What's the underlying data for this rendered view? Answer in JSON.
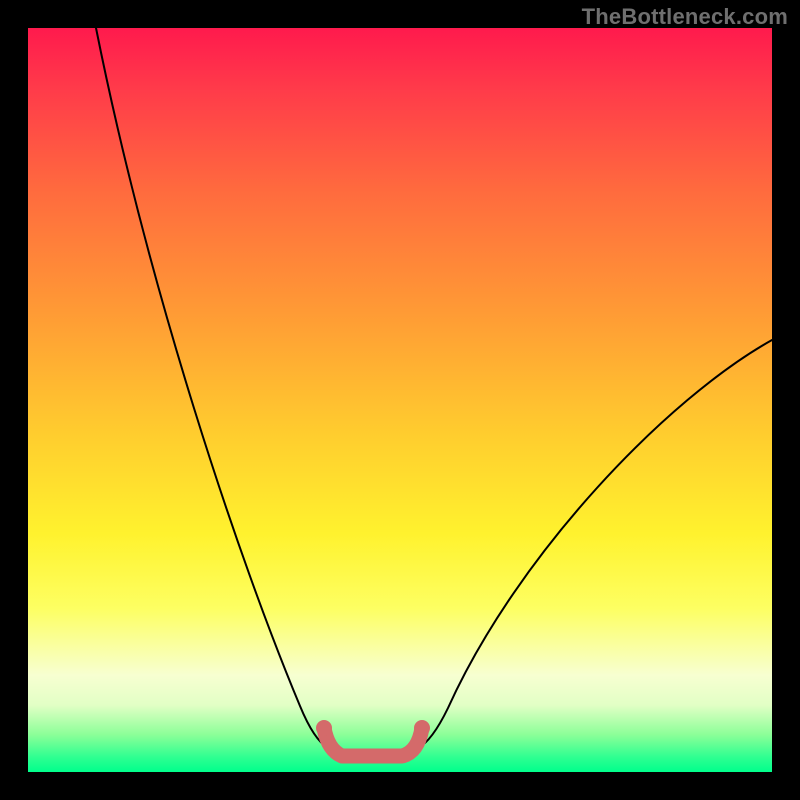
{
  "watermark": "TheBottleneck.com",
  "chart_data": {
    "type": "line",
    "title": "",
    "xlabel": "",
    "ylabel": "",
    "description": "Bottleneck V-curve: vertical axis is bottleneck percentage (high at top, 0 at bottom). Background gradient red→orange→yellow→green encodes severity. Two black curves descend to a minimum near x≈0.43 where a salmon U-shaped mark highlights the optimal zone.",
    "x_range_normalized": [
      0,
      1
    ],
    "y_range_percent": [
      0,
      100
    ],
    "gradient_stops": [
      {
        "pct": 0,
        "color": "#ff1a4d"
      },
      {
        "pct": 8,
        "color": "#ff3a4a"
      },
      {
        "pct": 22,
        "color": "#ff6b3e"
      },
      {
        "pct": 38,
        "color": "#ff9a35"
      },
      {
        "pct": 55,
        "color": "#ffce2e"
      },
      {
        "pct": 68,
        "color": "#fff22e"
      },
      {
        "pct": 78,
        "color": "#fdff62"
      },
      {
        "pct": 87,
        "color": "#f7ffd1"
      },
      {
        "pct": 91,
        "color": "#e2ffc5"
      },
      {
        "pct": 95,
        "color": "#8bff98"
      },
      {
        "pct": 98,
        "color": "#2fff91"
      },
      {
        "pct": 100,
        "color": "#00ff8c"
      }
    ],
    "series": [
      {
        "name": "left-curve",
        "x": [
          0.09,
          0.16,
          0.28,
          0.37,
          0.4
        ],
        "y": [
          100,
          65,
          29,
          9,
          3
        ]
      },
      {
        "name": "right-curve",
        "x": [
          0.52,
          0.56,
          0.66,
          0.86,
          1.0
        ],
        "y": [
          3,
          9,
          29,
          50,
          58
        ]
      }
    ],
    "highlight": {
      "color": "#d46a6a",
      "x_range": [
        0.4,
        0.53
      ],
      "y_percent": 2
    }
  }
}
